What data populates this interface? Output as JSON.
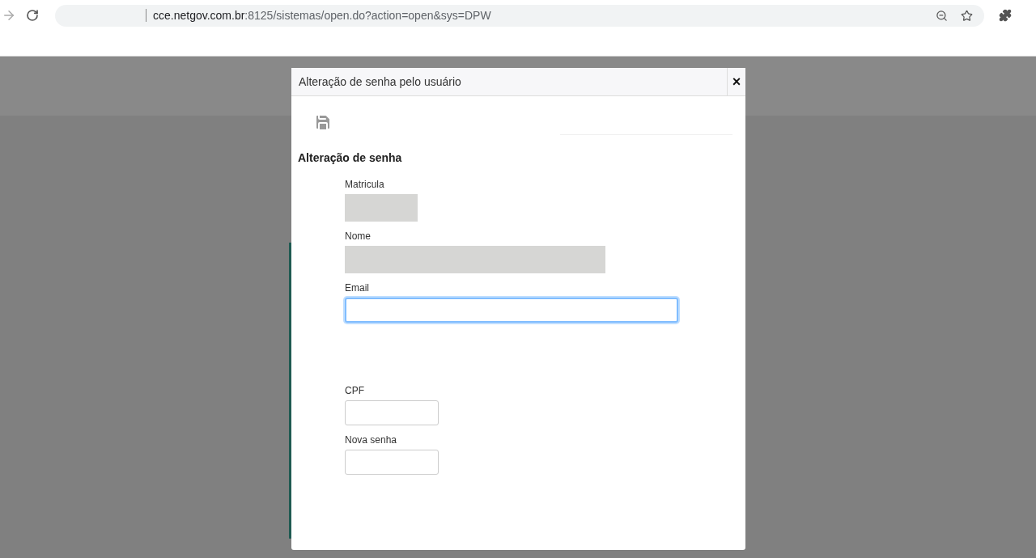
{
  "browser": {
    "url_domain": "cce.netgov.com.br",
    "url_path": ":8125/sistemas/open.do?action=open&sys=DPW"
  },
  "dialog": {
    "title": "Alteração de senha pelo usuário",
    "close": "×",
    "section_title": "Alteração de senha",
    "fields": [
      {
        "label": "Matricula",
        "kind": "id"
      },
      {
        "label": "Nome",
        "kind": "name"
      },
      {
        "label": "Email",
        "kind": "email",
        "focused": true
      },
      {
        "label": "CPF",
        "kind": "text",
        "focused": false
      },
      {
        "label": "Nova senha",
        "kind": "text",
        "focused": false
      }
    ]
  }
}
